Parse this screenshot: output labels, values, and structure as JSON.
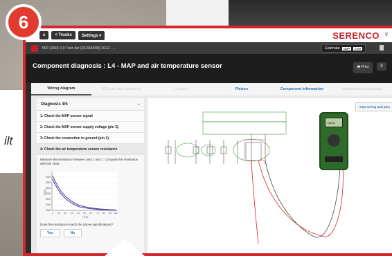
{
  "badge": "6",
  "side_text": "ilt",
  "topbar": {
    "back": "s",
    "trucks": "< Trucks",
    "settings": "Settings ▾",
    "logo": "SERENCO",
    "logo_icon": "♆"
  },
  "vehicle": {
    "label": "500 (150) 0.9 Twin Air (312A4000) 2012 - ...",
    "estimate": "Estimate",
    "currency": "GBP",
    "amount": "0.00"
  },
  "header": {
    "title": "Component diagnosis : L4 - MAP and air temperature sensor",
    "print": "🖶 Print",
    "close": "X"
  },
  "tabs": [
    {
      "label": "Wiring diagram",
      "state": "active"
    },
    {
      "label": "ECU pin and connector",
      "state": "disabled"
    },
    {
      "label": "Location",
      "state": "disabled"
    },
    {
      "label": "Picture",
      "state": "link"
    },
    {
      "label": "Component information",
      "state": "link"
    },
    {
      "label": "Initialisation procedures",
      "state": "disabled"
    }
  ],
  "diagnosis": {
    "heading": "Diagnosis 4/5",
    "collapse": "–",
    "steps": [
      "1: Check the MAP sensor signal",
      "2: Check the MAP sensor supply voltage (pin 3).",
      "3: Check the connection to ground (pin 1).",
      "4: Check the air temperature sensor resistance"
    ],
    "instruction": "Measure the resistance between pins 2 and 1. Compare the resistance with this chart:",
    "graph_ylabel": "R(Ω)",
    "graph_xlabel": "T(°C)",
    "yticks": [
      "7000",
      "6000",
      "5000",
      "4000",
      "3000",
      "2000",
      "1000",
      "0"
    ],
    "xticks": [
      "0",
      "10",
      "20",
      "30",
      "40",
      "50",
      "60",
      "70",
      "80",
      "90",
      "100"
    ],
    "question": "Does the resistance match the above specifications?",
    "yes": "Yes",
    "no": "No"
  },
  "right": {
    "view_button": "View wiring and pins",
    "screen_value": "Ωhms"
  }
}
